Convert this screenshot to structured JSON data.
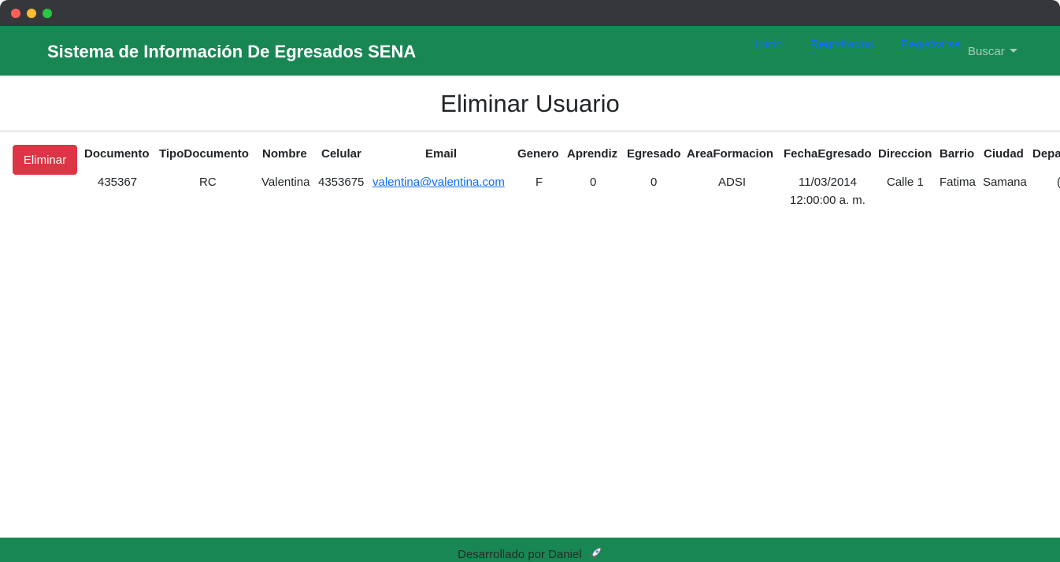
{
  "navbar": {
    "brand": "Sistema de Información De Egresados SENA",
    "links": [
      "Inicio",
      "Registrados",
      "Registrarse"
    ],
    "dropdown_label": "Buscar",
    "bg_color": "#198754"
  },
  "page": {
    "title": "Eliminar Usuario"
  },
  "actions": {
    "delete_label": "Eliminar",
    "delete_color": "#dc3545"
  },
  "table": {
    "headers": [
      "Documento",
      "TipoDocumento",
      "Nombre",
      "Celular",
      "Email",
      "Genero",
      "Aprendiz",
      "Egresado",
      "AreaFormacion",
      "FechaEgresado",
      "Direccion",
      "Barrio",
      "Ciudad",
      "Depa"
    ],
    "row": {
      "documento": "435367",
      "tipo_documento": "RC",
      "nombre": "Valentina",
      "celular": "4353675",
      "email": "valentina@valentina.com",
      "genero": "F",
      "aprendiz": "0",
      "egresado": "0",
      "area_formacion": "ADSI",
      "fecha_egresado_date": "11/03/2014",
      "fecha_egresado_time": "12:00:00 a. m.",
      "direccion": "Calle 1",
      "barrio": "Fatima",
      "ciudad": "Samana",
      "depa": "("
    }
  },
  "footer": {
    "text": "Desarrollado por Daniel",
    "icon": "rocket-icon"
  }
}
